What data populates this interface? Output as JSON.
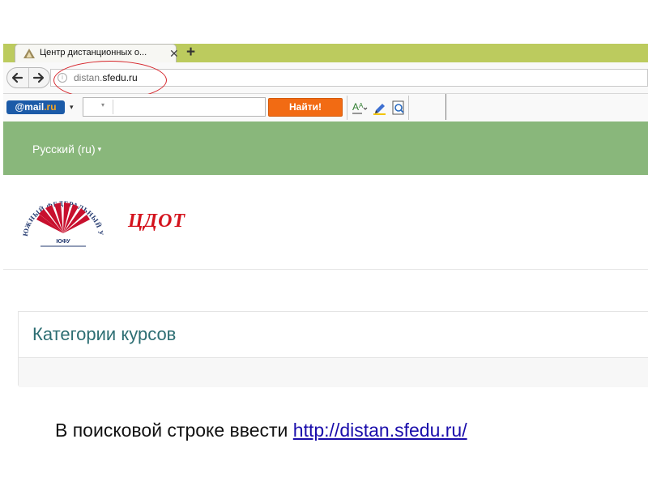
{
  "browser": {
    "tab": {
      "title": "Центр дистанционных о...",
      "close": "✕",
      "new_tab": "+"
    },
    "nav": {
      "back": "🡐",
      "forward": "🡒"
    },
    "address_bar": {
      "url_prefix": "distan.",
      "url_domain": "sfedu.ru",
      "info": "i"
    }
  },
  "mail_toolbar": {
    "logo": "@mail",
    "logo_suffix": ".ru",
    "dropdown": "▾",
    "search_value": "",
    "search_dropdown": "▾",
    "search_button": "Найти!"
  },
  "site": {
    "language_menu": "Русский (ru)",
    "language_caret": "▾",
    "cdot_logo": "ЦДОТ",
    "university_logo_text": "ЮЖНЫЙ ФЕДЕРАЛЬНЫЙ УНИВЕРСИТЕТ",
    "university_logo_abbr": "ЮФУ",
    "categories_title": "Категории курсов"
  },
  "caption": {
    "text": "В поисковой строке ввести ",
    "link": "http://distan.sfedu.ru/"
  },
  "colors": {
    "tabstrip": "#bccb5e",
    "header_green": "#89b77b",
    "find_button": "#f26b13",
    "highlight_red": "#d6252b",
    "cdot_red": "#d4131d",
    "title_teal": "#2d6e73"
  },
  "icons": [
    "favicon-triangle-icon",
    "back-arrow-icon",
    "forward-arrow-icon",
    "info-icon",
    "font-size-icon",
    "highlighter-icon",
    "page-zoom-icon"
  ]
}
